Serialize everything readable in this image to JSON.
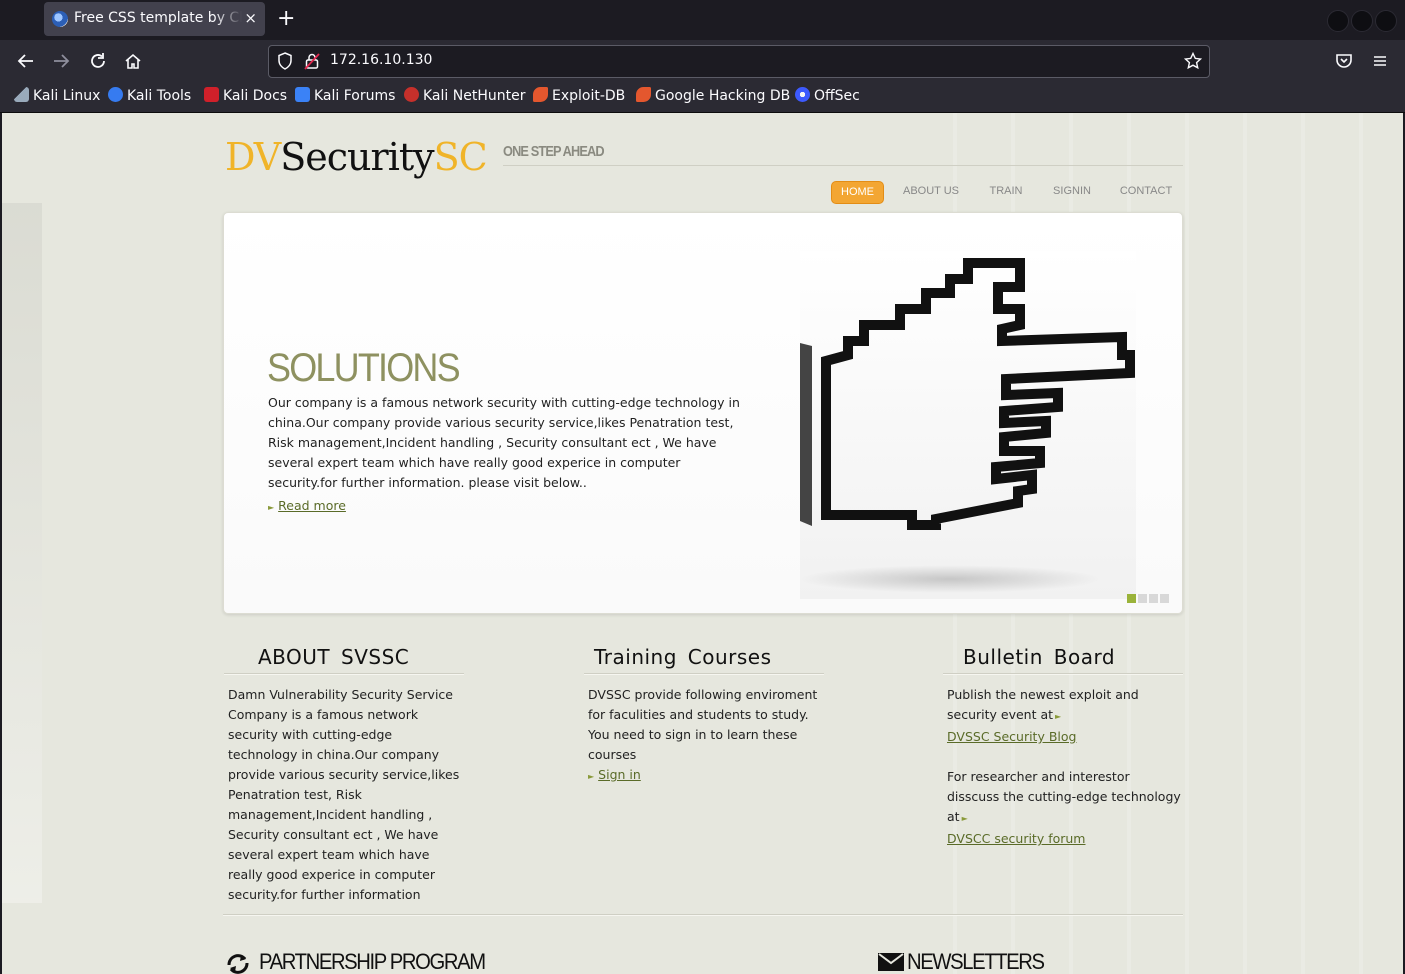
{
  "browser": {
    "tab_title": "Free CSS template by ChocoTemplates.com",
    "tab_close": "×",
    "new_tab": "+",
    "url": "172.16.10.130",
    "bookmarks": [
      {
        "label": "Kali Linux",
        "icon": "kali-dragon-icon"
      },
      {
        "label": "Kali Tools",
        "icon": "kali-tools-icon"
      },
      {
        "label": "Kali Docs",
        "icon": "kali-docs-icon"
      },
      {
        "label": "Kali Forums",
        "icon": "kali-forums-icon"
      },
      {
        "label": "Kali NetHunter",
        "icon": "nethunter-icon"
      },
      {
        "label": "Exploit-DB",
        "icon": "exploit-db-icon"
      },
      {
        "label": "Google Hacking DB",
        "icon": "ghdb-icon"
      },
      {
        "label": "OffSec",
        "icon": "offsec-icon"
      }
    ]
  },
  "site": {
    "logo_part1": "DV",
    "logo_part2": "Security",
    "logo_part3": "SC",
    "tagline": "ONE STEP AHEAD",
    "menu": [
      "HOME",
      "ABOUT US",
      "TRAIN",
      "SIGNIN",
      "CONTACT"
    ],
    "active_menu": "HOME",
    "accent_color": "#f3a633",
    "green_color": "#8e9160"
  },
  "slider": {
    "title": "SOLUTIONS",
    "text": "Our company is a famous network security with cutting-edge technology in china.Our company provide various security service,likes Penatration test, Risk management,Incident handling , Security consultant ect , We have several expert team which have really good experice in computer security.for further information. please visit below..",
    "read_more": "Read more",
    "active_slide": 1,
    "slide_count": 4
  },
  "columns": {
    "about": {
      "title": "ABOUT SVSSC",
      "text": "Damn Vulnerability Security Service Company is a famous network security with cutting-edge technology in china.Our company provide various security service,likes Penatration test, Risk management,Incident handling , Security consultant ect , We have several expert team which have really good experice in computer security.for further information"
    },
    "training": {
      "title": "Training Courses",
      "text": "DVSSC provide following enviroment for faculities and students to study. You need to sign in to learn these courses",
      "link": "Sign in"
    },
    "bulletin": {
      "title": "Bulletin Board",
      "text1": "Publish the newest exploit and security event at",
      "link1": "DVSSC Security Blog",
      "text2": "For researcher and interestor disscuss the cutting-edge technology at",
      "link2": "DVSCC security forum"
    }
  },
  "footer": {
    "partnership": "PARTNERSHIP PROGRAM",
    "newsletters": "NEWSLETTERS"
  }
}
